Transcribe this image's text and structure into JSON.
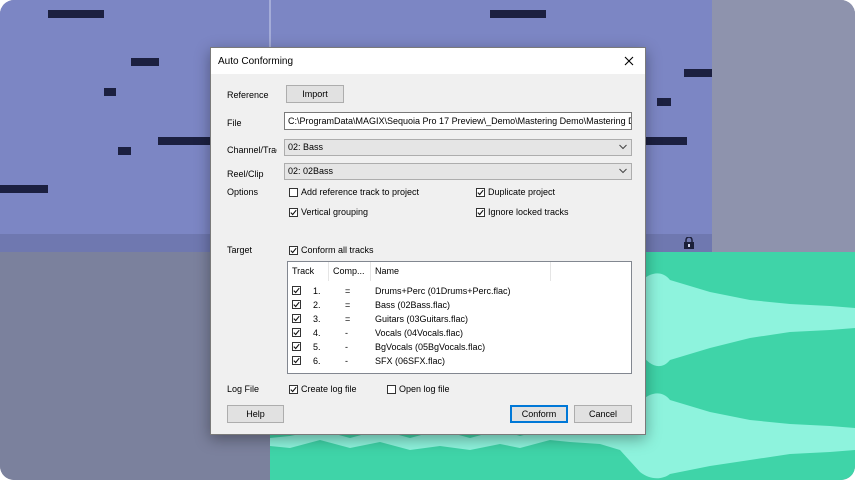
{
  "background": {
    "midi_color": "#7c86c4",
    "audio_color": "#3fd4a8",
    "lock_icon": "lock-icon"
  },
  "dialog": {
    "title": "Auto Conforming",
    "close_icon": "close-icon",
    "reference_label": "Reference",
    "import_label": "Import",
    "file_label": "File",
    "file_value": "C:\\ProgramData\\MAGIX\\Sequoia Pro 17 Preview\\_Demo\\Mastering Demo\\Mastering Demo.VIP",
    "channel_label": "Channel/Track",
    "channel_value": "02: Bass",
    "reel_label": "Reel/Clip",
    "reel_value": "02: 02Bass",
    "options_label": "Options",
    "options": {
      "add_reference": {
        "label": "Add reference track to project",
        "checked": false
      },
      "duplicate_project": {
        "label": "Duplicate project",
        "checked": true
      },
      "vertical_grouping": {
        "label": "Vertical grouping",
        "checked": true
      },
      "ignore_locked": {
        "label": "Ignore locked tracks",
        "checked": true
      }
    },
    "target_label": "Target",
    "conform_all": {
      "label": "Conform all tracks",
      "checked": true
    },
    "list": {
      "headers": {
        "track": "Track",
        "comp": "Comp...",
        "name": "Name"
      },
      "rows": [
        {
          "checked": true,
          "num": "1.",
          "comp": "=",
          "name": "Drums+Perc (01Drums+Perc.flac)"
        },
        {
          "checked": true,
          "num": "2.",
          "comp": "=",
          "name": "Bass (02Bass.flac)"
        },
        {
          "checked": true,
          "num": "3.",
          "comp": "=",
          "name": "Guitars (03Guitars.flac)"
        },
        {
          "checked": true,
          "num": "4.",
          "comp": "-",
          "name": "Vocals (04Vocals.flac)"
        },
        {
          "checked": true,
          "num": "5.",
          "comp": "-",
          "name": "BgVocals (05BgVocals.flac)"
        },
        {
          "checked": true,
          "num": "6.",
          "comp": "-",
          "name": "SFX (06SFX.flac)"
        }
      ]
    },
    "logfile_label": "Log File",
    "create_log": {
      "label": "Create log file",
      "checked": true
    },
    "open_log": {
      "label": "Open log file",
      "checked": false
    },
    "help_label": "Help",
    "conform_label": "Conform",
    "cancel_label": "Cancel",
    "accent_color": "#0078d7"
  }
}
